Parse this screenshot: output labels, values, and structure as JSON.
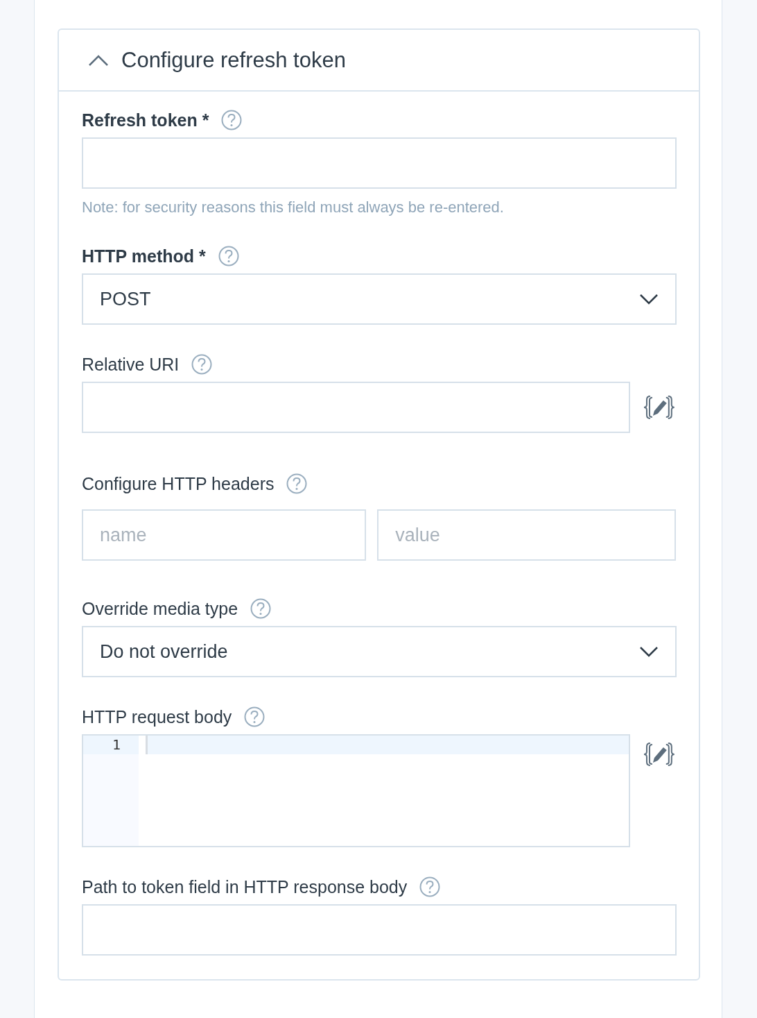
{
  "panel": {
    "title": "Configure refresh token",
    "expanded": true
  },
  "fields": [
    {
      "kind": "text",
      "label": "Refresh token *",
      "required": true,
      "note": "Note: for security reasons this field must always be re-entered."
    },
    {
      "kind": "select",
      "label": "HTTP method *",
      "required": true,
      "value": "POST"
    },
    {
      "kind": "uri",
      "label": "Relative URI",
      "required": false
    },
    {
      "kind": "headers",
      "label": "Configure HTTP headers",
      "required": false,
      "name_placeholder": "name",
      "value_placeholder": "value"
    },
    {
      "kind": "select",
      "label": "Override media type",
      "required": false,
      "value": "Do not override"
    },
    {
      "kind": "editor",
      "label": "HTTP request body",
      "required": false,
      "line_numbers": [
        "1"
      ]
    },
    {
      "kind": "text",
      "label": "Path to token field in HTTP response body",
      "required": false
    }
  ]
}
